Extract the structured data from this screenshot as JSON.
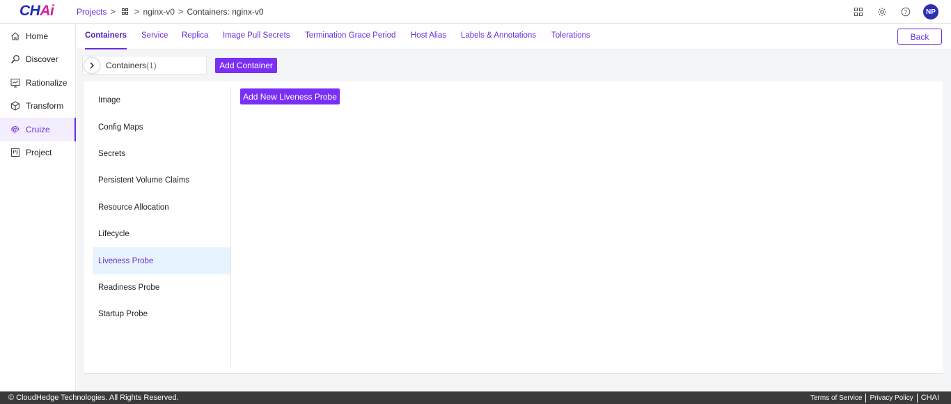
{
  "app": {
    "logo_main": "CH",
    "logo_accent": "Ai"
  },
  "breadcrumb": {
    "projects": "Projects",
    "project_name": "nginx-v0",
    "current": "Containers: nginx-v0"
  },
  "header": {
    "avatar_initials": "NP"
  },
  "sidebar": {
    "items": [
      {
        "label": "Home",
        "icon": "home-icon"
      },
      {
        "label": "Discover",
        "icon": "search-icon"
      },
      {
        "label": "Rationalize",
        "icon": "chart-icon"
      },
      {
        "label": "Transform",
        "icon": "cube-icon"
      },
      {
        "label": "Cruize",
        "icon": "fingerprint-icon",
        "active": true
      },
      {
        "label": "Project",
        "icon": "board-icon"
      }
    ]
  },
  "tabs": [
    {
      "label": "Containers",
      "active": true
    },
    {
      "label": "Service"
    },
    {
      "label": "Replica"
    },
    {
      "label": "Image Pull Secrets"
    },
    {
      "label": "Termination Grace Period"
    },
    {
      "label": "Host Alias"
    },
    {
      "label": "Labels & Annotations"
    },
    {
      "label": "Tolerations"
    }
  ],
  "back_label": "Back",
  "containers": {
    "label": "Containers",
    "count": "(1)",
    "add_label": "Add Container"
  },
  "config_list": {
    "items": [
      {
        "label": "Image"
      },
      {
        "label": "Config Maps"
      },
      {
        "label": "Secrets"
      },
      {
        "label": "Persistent Volume Claims"
      },
      {
        "label": "Resource Allocation"
      },
      {
        "label": "Lifecycle"
      },
      {
        "label": "Liveness Probe",
        "active": true
      },
      {
        "label": "Readiness Probe"
      },
      {
        "label": "Startup Probe"
      }
    ]
  },
  "content": {
    "add_probe_label": "Add New Liveness Probe"
  },
  "footer": {
    "copyright": "© CloudHedge Technologies. All Rights Reserved.",
    "terms": "Terms of Service",
    "privacy": "Privacy Policy",
    "brand": "CHAI"
  },
  "colors": {
    "accent": "#7a2ff5",
    "accent_text": "#6a2ce0",
    "footer_bg": "#3a3a3a"
  }
}
